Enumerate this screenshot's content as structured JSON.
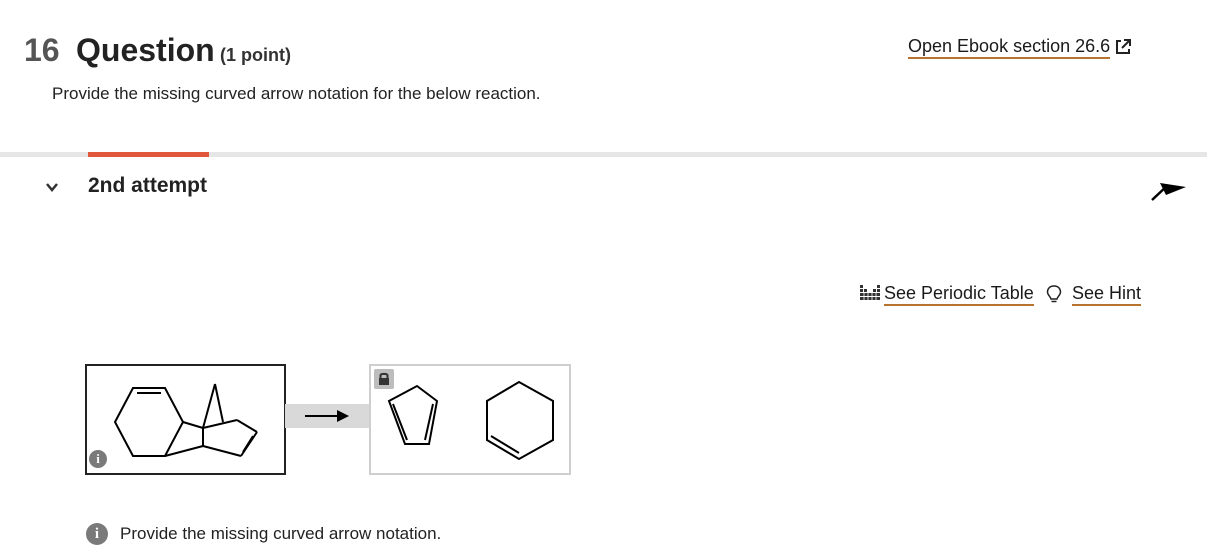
{
  "question": {
    "number": "16",
    "title": "Question",
    "points": "(1 point)",
    "prompt": "Provide the missing curved arrow notation for the below reaction."
  },
  "ebook": {
    "label": "Open Ebook section  26.6",
    "icon": "external-link-icon"
  },
  "attempt": {
    "label": "2nd attempt",
    "expanded": true
  },
  "tools": {
    "periodic_label": "See Periodic Table",
    "periodic_icon": "periodic-table-icon",
    "hint_label": "See Hint",
    "hint_icon": "lightbulb-icon"
  },
  "reaction": {
    "reactant_info_glyph": "i",
    "products_locked": true
  },
  "feedback": {
    "glyph": "i",
    "text": "Provide the missing curved arrow notation."
  },
  "colors": {
    "accent_tab": "#e0573b",
    "link_underline": "#b8732e",
    "divider": "#e6e6e6"
  }
}
